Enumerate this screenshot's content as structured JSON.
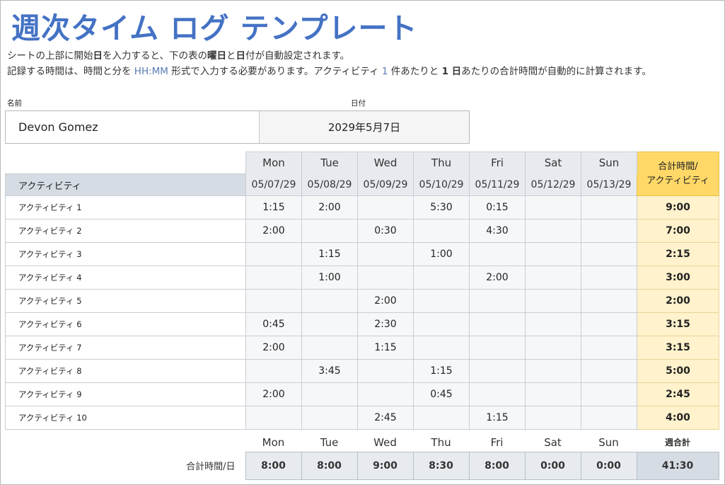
{
  "title": "週次タイム ログ テンプレート",
  "instructions": {
    "line1_parts": [
      "シートの上部に開始",
      "日",
      "を入力すると、下の表の",
      "曜日",
      "と",
      "日",
      "付が自動設定されます。"
    ],
    "line2_parts": [
      "記録する時間は、時間と分を ",
      "HH:MM",
      " 形式で入力する必要があります。アクティビティ ",
      "1",
      " 件あたりと ",
      "1 日",
      "あたりの合計時間が自動的に計算されます。"
    ]
  },
  "info": {
    "name_label": "名前",
    "date_label": "日付",
    "name_value": "Devon Gomez",
    "date_value": "2029年5月7日"
  },
  "table": {
    "activity_header": "アクティビティ",
    "total_header_line1": "合計時間/",
    "total_header_line2": "アクティビティ",
    "days": [
      "Mon",
      "Tue",
      "Wed",
      "Thu",
      "Fri",
      "Sat",
      "Sun"
    ],
    "dates": [
      "05/07/29",
      "05/08/29",
      "05/09/29",
      "05/10/29",
      "05/11/29",
      "05/12/29",
      "05/13/29"
    ],
    "rows": [
      {
        "label": "アクティビティ 1",
        "hours": [
          "1:15",
          "2:00",
          "",
          "5:30",
          "0:15",
          "",
          ""
        ],
        "total": "9:00"
      },
      {
        "label": "アクティビティ 2",
        "hours": [
          "2:00",
          "",
          "0:30",
          "",
          "4:30",
          "",
          ""
        ],
        "total": "7:00"
      },
      {
        "label": "アクティビティ 3",
        "hours": [
          "",
          "1:15",
          "",
          "1:00",
          "",
          "",
          ""
        ],
        "total": "2:15"
      },
      {
        "label": "アクティビティ 4",
        "hours": [
          "",
          "1:00",
          "",
          "",
          "2:00",
          "",
          ""
        ],
        "total": "3:00"
      },
      {
        "label": "アクティビティ 5",
        "hours": [
          "",
          "",
          "2:00",
          "",
          "",
          "",
          ""
        ],
        "total": "2:00"
      },
      {
        "label": "アクティビティ 6",
        "hours": [
          "0:45",
          "",
          "2:30",
          "",
          "",
          "",
          ""
        ],
        "total": "3:15"
      },
      {
        "label": "アクティビティ 7",
        "hours": [
          "2:00",
          "",
          "1:15",
          "",
          "",
          "",
          ""
        ],
        "total": "3:15"
      },
      {
        "label": "アクティビティ 8",
        "hours": [
          "",
          "3:45",
          "",
          "1:15",
          "",
          "",
          ""
        ],
        "total": "5:00"
      },
      {
        "label": "アクティビティ 9",
        "hours": [
          "2:00",
          "",
          "",
          "0:45",
          "",
          "",
          ""
        ],
        "total": "2:45"
      },
      {
        "label": "アクティビティ 10",
        "hours": [
          "",
          "",
          "2:45",
          "",
          "1:15",
          "",
          ""
        ],
        "total": "4:00"
      }
    ]
  },
  "summary": {
    "days": [
      "Mon",
      "Tue",
      "Wed",
      "Thu",
      "Fri",
      "Sat",
      "Sun"
    ],
    "week_total_label": "週合計",
    "row_label": "合計時間/日",
    "day_totals": [
      "8:00",
      "8:00",
      "9:00",
      "8:30",
      "8:00",
      "0:00",
      "0:00"
    ],
    "week_total": "41:30"
  }
}
